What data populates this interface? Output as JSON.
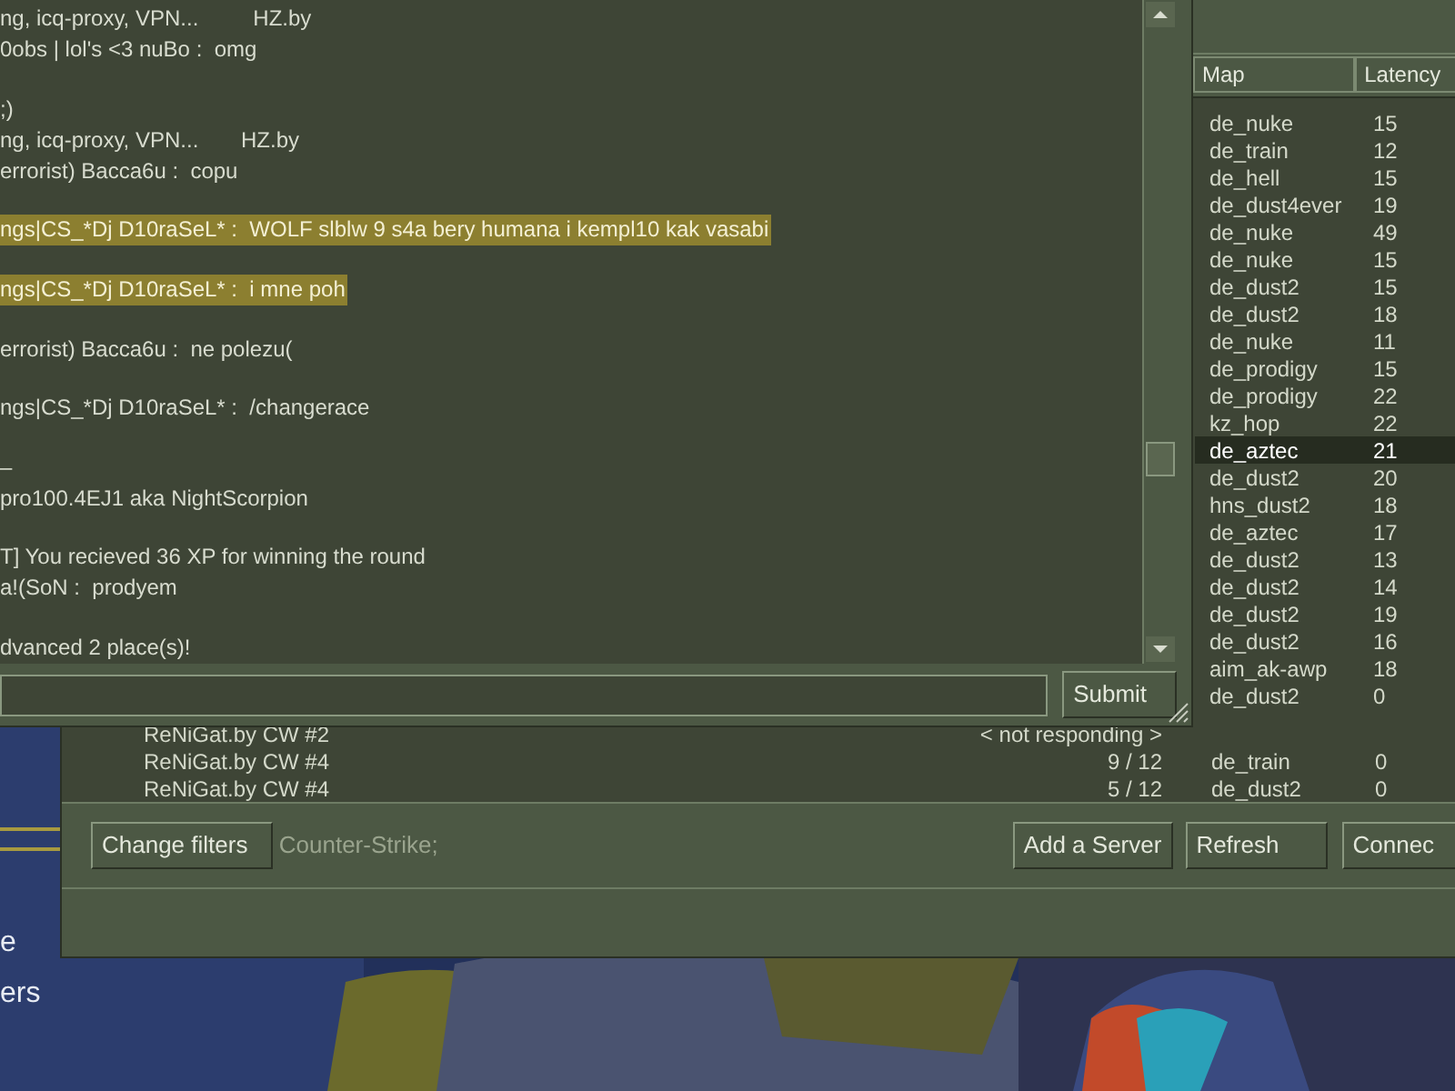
{
  "chat": {
    "lines": [
      {
        "kind": "message",
        "text": "ng, icq-proxy, VPN...         HZ.by",
        "highlighted": false
      },
      {
        "kind": "message",
        "text": "0obs | lol's <3 nuBo :  omg",
        "highlighted": false
      },
      {
        "kind": "spacer"
      },
      {
        "kind": "message",
        "text": ";)",
        "highlighted": false
      },
      {
        "kind": "message",
        "text": "ng, icq-proxy, VPN...       HZ.by",
        "highlighted": false
      },
      {
        "kind": "message",
        "text": "errorist) Bacca6u :  copu",
        "highlighted": false
      },
      {
        "kind": "spacer"
      },
      {
        "kind": "message",
        "text": "ngs|CS_*Dj D10raSeL* :  WOLF slblw 9 s4a bery humana i kempl10 kak vasabi",
        "highlighted": true
      },
      {
        "kind": "spacer"
      },
      {
        "kind": "message",
        "text": "ngs|CS_*Dj D10raSeL* :  i mne poh",
        "highlighted": true
      },
      {
        "kind": "spacer"
      },
      {
        "kind": "message",
        "text": "errorist) Bacca6u :  ne polezu(",
        "highlighted": false
      },
      {
        "kind": "spacer"
      },
      {
        "kind": "message",
        "text": "ngs|CS_*Dj D10raSeL* :  /changerace",
        "highlighted": false
      },
      {
        "kind": "spacer"
      },
      {
        "kind": "message",
        "text": "–",
        "highlighted": false
      },
      {
        "kind": "message",
        "text": "pro100.4EJ1 aka NightScorpion",
        "highlighted": false
      },
      {
        "kind": "spacer"
      },
      {
        "kind": "message",
        "text": "T] You recieved 36 XP for winning the round",
        "highlighted": false
      },
      {
        "kind": "message",
        "text": "a!(SoN :  prodyem",
        "highlighted": false
      },
      {
        "kind": "spacer"
      },
      {
        "kind": "message",
        "text": "dvanced 2 place(s)!",
        "highlighted": false
      }
    ],
    "submit": "Submit"
  },
  "server_list": {
    "columns": [
      "Map",
      "Latency"
    ],
    "rows": [
      {
        "map": "de_nuke",
        "latency": "15",
        "selected": false
      },
      {
        "map": "de_train",
        "latency": "12",
        "selected": false
      },
      {
        "map": "de_hell",
        "latency": "15",
        "selected": false
      },
      {
        "map": "de_dust4ever",
        "latency": "19",
        "selected": false
      },
      {
        "map": "de_nuke",
        "latency": "49",
        "selected": false
      },
      {
        "map": "de_nuke",
        "latency": "15",
        "selected": false
      },
      {
        "map": "de_dust2",
        "latency": "15",
        "selected": false
      },
      {
        "map": "de_dust2",
        "latency": "18",
        "selected": false
      },
      {
        "map": "de_nuke",
        "latency": "11",
        "selected": false
      },
      {
        "map": "de_prodigy",
        "latency": "15",
        "selected": false
      },
      {
        "map": "de_prodigy",
        "latency": "22",
        "selected": false
      },
      {
        "map": "kz_hop",
        "latency": "22",
        "selected": false
      },
      {
        "map": "de_aztec",
        "latency": "21",
        "selected": true
      },
      {
        "map": "de_dust2",
        "latency": "20",
        "selected": false
      },
      {
        "map": "hns_dust2",
        "latency": "18",
        "selected": false
      },
      {
        "map": "de_aztec",
        "latency": "17",
        "selected": false
      },
      {
        "map": "de_dust2",
        "latency": "13",
        "selected": false
      },
      {
        "map": "de_dust2",
        "latency": "14",
        "selected": false
      },
      {
        "map": "de_dust2",
        "latency": "19",
        "selected": false
      },
      {
        "map": "de_dust2",
        "latency": "16",
        "selected": false
      },
      {
        "map": "aim_ak-awp",
        "latency": "18",
        "selected": false
      },
      {
        "map": "de_dust2",
        "latency": "0",
        "selected": false
      }
    ],
    "lower_rows": [
      {
        "name": "ReNiGat.by CW #2",
        "players": "< not responding >"
      },
      {
        "name": "ReNiGat.by CW #4",
        "players": "9 / 12",
        "map": "de_train",
        "latency": "0"
      },
      {
        "name": "ReNiGat.by CW #4",
        "players": "5 / 12",
        "map": "de_dust2",
        "latency": "0"
      }
    ]
  },
  "footer": {
    "change_filters": "Change filters",
    "filter_text": "Counter-Strike;",
    "add_server": "Add a Server",
    "refresh": "Refresh",
    "connect": "Connec"
  },
  "main_menu": [
    "e",
    "ers"
  ]
}
